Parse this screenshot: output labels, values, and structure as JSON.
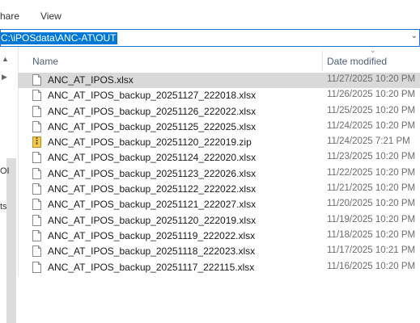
{
  "ribbon": {
    "tabs": [
      "Share",
      "View"
    ]
  },
  "address": {
    "path": "C:\\iPOSdata\\ANC-AT\\OUT"
  },
  "nav": {
    "fragments": [
      "OI",
      "ts"
    ]
  },
  "columns": {
    "name": "Name",
    "date_modified": "Date modified"
  },
  "files": [
    {
      "name": "ANC_AT_IPOS.xlsx",
      "date": "11/27/2025 10:20 PM",
      "type": "xlsx",
      "selected": true
    },
    {
      "name": "ANC_AT_IPOS_backup_20251127_222018.xlsx",
      "date": "11/26/2025 10:20 PM",
      "type": "xlsx"
    },
    {
      "name": "ANC_AT_IPOS_backup_20251126_222022.xlsx",
      "date": "11/25/2025 10:20 PM",
      "type": "xlsx"
    },
    {
      "name": "ANC_AT_IPOS_backup_20251125_222025.xlsx",
      "date": "11/24/2025 10:20 PM",
      "type": "xlsx"
    },
    {
      "name": "ANC_AT_IPOS_backup_20251120_222019.zip",
      "date": "11/24/2025 7:21 PM",
      "type": "zip"
    },
    {
      "name": "ANC_AT_IPOS_backup_20251124_222020.xlsx",
      "date": "11/23/2025 10:20 PM",
      "type": "xlsx"
    },
    {
      "name": "ANC_AT_IPOS_backup_20251123_222026.xlsx",
      "date": "11/22/2025 10:20 PM",
      "type": "xlsx"
    },
    {
      "name": "ANC_AT_IPOS_backup_20251122_222022.xlsx",
      "date": "11/21/2025 10:20 PM",
      "type": "xlsx"
    },
    {
      "name": "ANC_AT_IPOS_backup_20251121_222027.xlsx",
      "date": "11/20/2025 10:20 PM",
      "type": "xlsx"
    },
    {
      "name": "ANC_AT_IPOS_backup_20251120_222019.xlsx",
      "date": "11/19/2025 10:20 PM",
      "type": "xlsx"
    },
    {
      "name": "ANC_AT_IPOS_backup_20251119_222022.xlsx",
      "date": "11/18/2025 10:20 PM",
      "type": "xlsx"
    },
    {
      "name": "ANC_AT_IPOS_backup_20251118_222023.xlsx",
      "date": "11/17/2025 10:21 PM",
      "type": "xlsx"
    },
    {
      "name": "ANC_AT_IPOS_backup_20251117_222115.xlsx",
      "date": "11/16/2025 10:20 PM",
      "type": "xlsx"
    }
  ],
  "colors": {
    "selection": "#0078d7",
    "row_selected": "#d9d9d9",
    "zip_icon": "#f2c94c"
  }
}
